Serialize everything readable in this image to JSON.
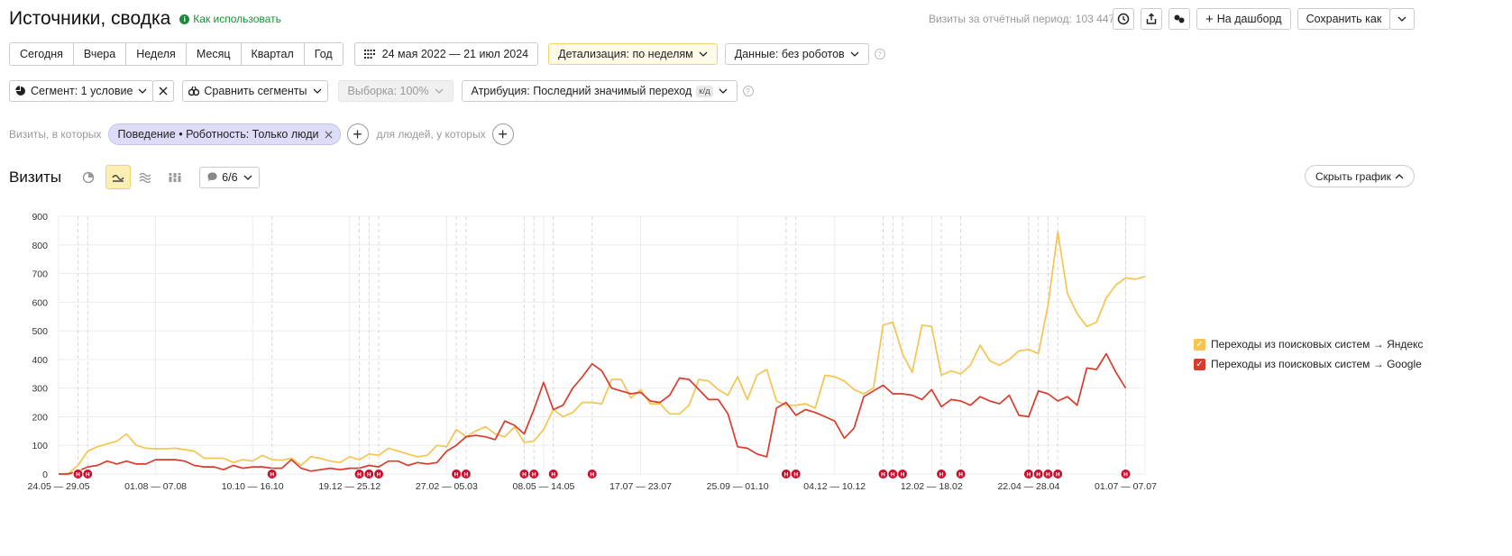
{
  "header": {
    "title": "Источники, сводка",
    "how_to_use": "Как использовать",
    "visits_period_label": "Визиты за отчётный период:",
    "visits_period_value": "103 447",
    "to_dashboard": "На дашборд",
    "save_as": "Сохранить как"
  },
  "period_buttons": [
    "Сегодня",
    "Вчера",
    "Неделя",
    "Месяц",
    "Квартал",
    "Год"
  ],
  "date_range": "24 мая 2022 — 21 июл 2024",
  "detail": "Детализация: по неделям",
  "data_filter": "Данные: без роботов",
  "segment": "Сегмент: 1 условие",
  "compare_segments": "Сравнить сегменты",
  "sample": "Выборка: 100%",
  "attribution": "Атрибуция: Последний значимый переход",
  "attribution_badge": "к/д",
  "filter_row": {
    "visits_where": "Визиты, в которых",
    "chip": "Поведение • Роботность: Только люди",
    "people_where": "для людей, у которых"
  },
  "chart_header": {
    "title": "Визиты",
    "annotations_count": "6/6",
    "hide_chart": "Скрыть график"
  },
  "colors": {
    "yandex": "#f5c451",
    "google": "#d83c2e",
    "accent": "#fdeeb3",
    "marker": "#c8102e"
  },
  "chart_data": {
    "type": "line",
    "ylim": [
      0,
      900
    ],
    "yticks": [
      0,
      100,
      200,
      300,
      400,
      500,
      600,
      700,
      800,
      900
    ],
    "xticks": [
      {
        "i": 0,
        "label": "24.05 — 29.05"
      },
      {
        "i": 10,
        "label": "01.08 — 07.08"
      },
      {
        "i": 20,
        "label": "10.10 — 16.10"
      },
      {
        "i": 30,
        "label": "19.12 — 25.12"
      },
      {
        "i": 40,
        "label": "27.02 — 05.03"
      },
      {
        "i": 50,
        "label": "08.05 — 14.05"
      },
      {
        "i": 60,
        "label": "17.07 — 23.07"
      },
      {
        "i": 70,
        "label": "25.09 — 01.10"
      },
      {
        "i": 80,
        "label": "04.12 — 10.12"
      },
      {
        "i": 90,
        "label": "12.02 — 18.02"
      },
      {
        "i": 100,
        "label": "22.04 — 28.04"
      },
      {
        "i": 110,
        "label": "01.07 — 07.07"
      }
    ],
    "series": [
      {
        "name": "Переходы из поисковых систем → Яндекс",
        "color": "#f5c451",
        "values": [
          0,
          2,
          30,
          80,
          95,
          105,
          115,
          140,
          100,
          90,
          88,
          88,
          90,
          85,
          80,
          55,
          55,
          55,
          40,
          50,
          45,
          65,
          50,
          48,
          55,
          30,
          60,
          55,
          45,
          40,
          60,
          50,
          70,
          65,
          90,
          80,
          70,
          60,
          65,
          100,
          95,
          155,
          130,
          150,
          165,
          140,
          130,
          165,
          110,
          115,
          155,
          225,
          200,
          215,
          250,
          250,
          245,
          330,
          330,
          265,
          295,
          245,
          245,
          210,
          210,
          240,
          330,
          325,
          295,
          275,
          340,
          260,
          345,
          365,
          255,
          240,
          240,
          245,
          230,
          345,
          340,
          325,
          295,
          280,
          300,
          520,
          530,
          420,
          355,
          520,
          515,
          345,
          360,
          350,
          380,
          450,
          395,
          380,
          400,
          430,
          435,
          420,
          590,
          845,
          630,
          560,
          515,
          530,
          615,
          660,
          685,
          680,
          690
        ]
      },
      {
        "name": "Переходы из поисковых систем → Google",
        "color": "#d83c2e",
        "values": [
          0,
          0,
          10,
          25,
          30,
          45,
          35,
          45,
          35,
          35,
          50,
          50,
          50,
          45,
          30,
          25,
          25,
          15,
          30,
          20,
          25,
          25,
          20,
          20,
          50,
          20,
          10,
          15,
          20,
          15,
          20,
          20,
          30,
          25,
          45,
          45,
          30,
          40,
          35,
          40,
          80,
          100,
          130,
          135,
          130,
          120,
          185,
          170,
          140,
          225,
          320,
          225,
          240,
          300,
          340,
          385,
          360,
          300,
          290,
          280,
          285,
          255,
          250,
          275,
          335,
          330,
          295,
          260,
          260,
          210,
          95,
          90,
          70,
          60,
          230,
          250,
          205,
          225,
          215,
          200,
          185,
          125,
          160,
          270,
          290,
          310,
          280,
          280,
          275,
          260,
          295,
          235,
          260,
          255,
          240,
          270,
          255,
          245,
          275,
          205,
          200,
          290,
          280,
          255,
          270,
          240,
          370,
          365,
          420,
          355,
          300
        ]
      }
    ],
    "annotation_markers": [
      2,
      3,
      22,
      31,
      32,
      33,
      41,
      42,
      48,
      49,
      51,
      55,
      75,
      76,
      85,
      86,
      87,
      91,
      93,
      100,
      101,
      102,
      103,
      110
    ],
    "annotation_marker_label": "Н"
  }
}
